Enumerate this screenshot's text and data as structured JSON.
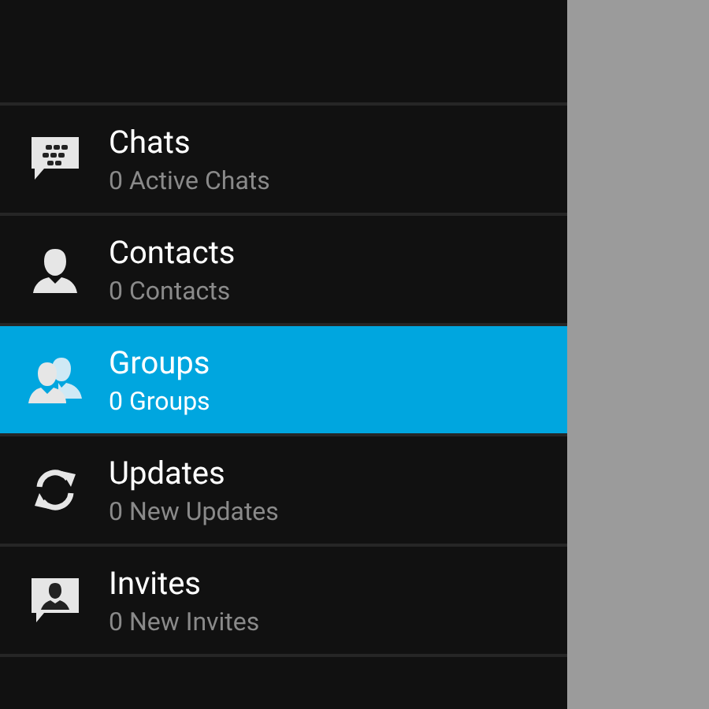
{
  "menu": {
    "items": [
      {
        "kind": "chat",
        "title": "Chats",
        "subtitle": "0 Active Chats",
        "selected": false
      },
      {
        "kind": "contact",
        "title": "Contacts",
        "subtitle": "0 Contacts",
        "selected": false
      },
      {
        "kind": "group",
        "title": "Groups",
        "subtitle": "0 Groups",
        "selected": true
      },
      {
        "kind": "update",
        "title": "Updates",
        "subtitle": "0 New Updates",
        "selected": false
      },
      {
        "kind": "invite",
        "title": "Invites",
        "subtitle": "0 New Invites",
        "selected": false
      }
    ]
  }
}
